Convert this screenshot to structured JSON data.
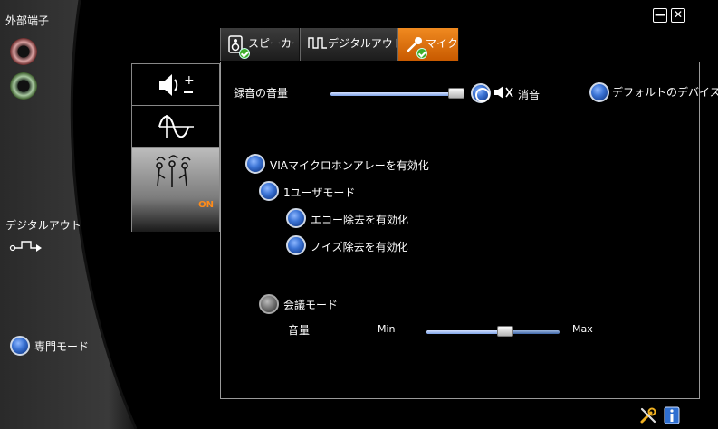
{
  "window": {
    "minimize_label": "—",
    "close_label": "✕"
  },
  "left": {
    "external_ports_label": "外部端子",
    "digital_out_label": "デジタルアウト",
    "expert_mode_label": "専門モード"
  },
  "tabs": [
    {
      "label": "スピーカー",
      "icon": "speaker-icon",
      "active": false
    },
    {
      "label": "デジタルアウト",
      "icon": "digital-wave-icon",
      "active": false
    },
    {
      "label": "マイク",
      "icon": "microphone-icon",
      "active": true
    }
  ],
  "side": {
    "on_label": "ON"
  },
  "main": {
    "record_volume_label": "録音の音量",
    "record_volume_value": 0.95,
    "mute_label": "消音",
    "default_device_label": "デフォルトのデバイス",
    "via_array_label": "VIAマイクロホンアレーを有効化",
    "one_user_label": "1ユーザモード",
    "echo_label": "エコー除去を有効化",
    "noise_label": "ノイズ除去を有効化",
    "conference_label": "会議モード",
    "volume_label": "音量",
    "min_label": "Min",
    "max_label": "Max",
    "conference_volume_value": 0.59
  },
  "colors": {
    "accent_orange": "#e07a10",
    "radio_blue": "#3d75d6",
    "on_orange": "#ff8c1a"
  }
}
